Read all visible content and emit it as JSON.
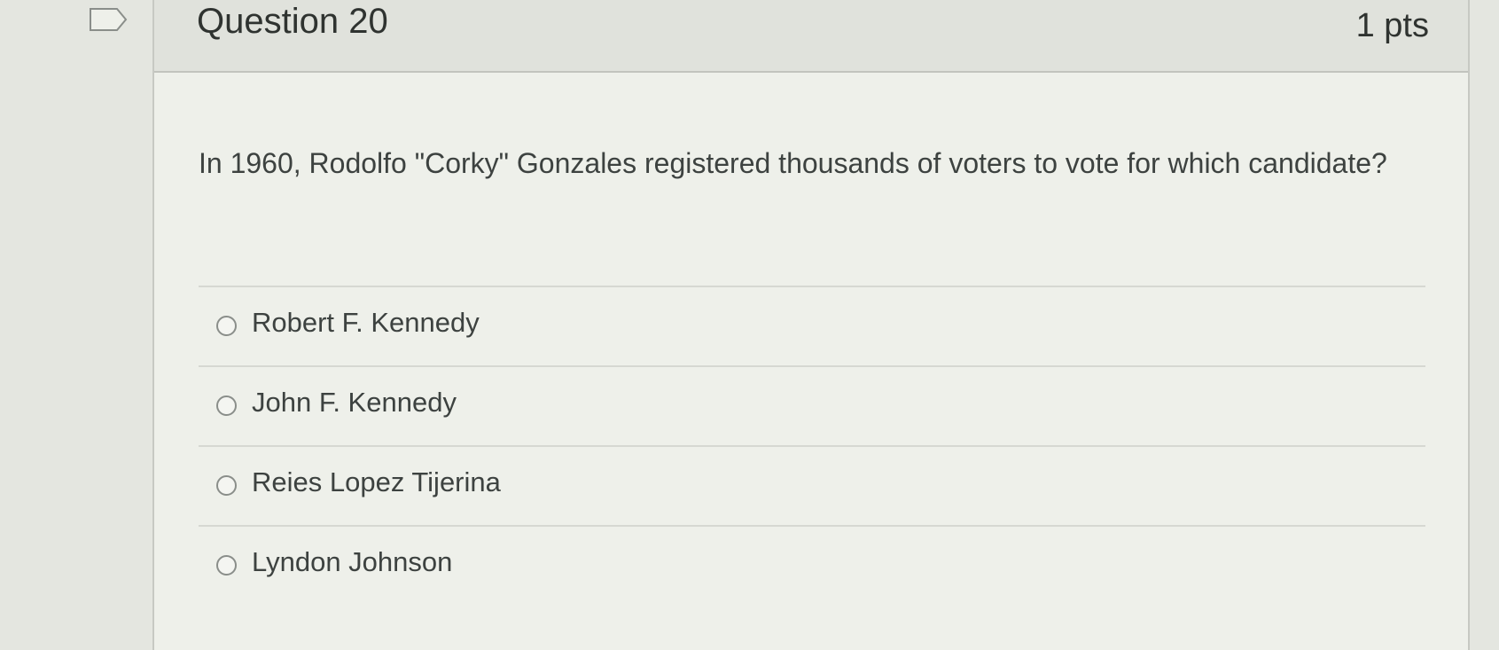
{
  "question": {
    "title": "Question 20",
    "points": "1 pts",
    "text": "In 1960, Rodolfo \"Corky\" Gonzales registered thousands of voters to vote for which candidate?",
    "answers": [
      {
        "label": "Robert F. Kennedy"
      },
      {
        "label": "John F. Kennedy"
      },
      {
        "label": "Reies Lopez Tijerina"
      },
      {
        "label": "Lyndon Johnson"
      }
    ]
  },
  "icons": {
    "flag": "flag-icon",
    "radio": "radio-unchecked-icon"
  }
}
